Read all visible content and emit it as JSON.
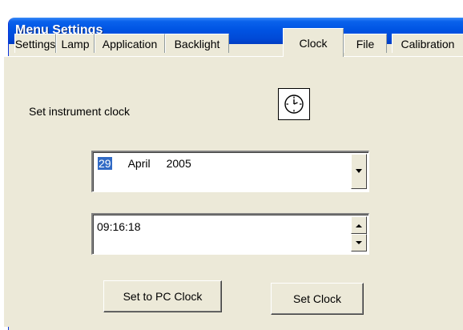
{
  "window": {
    "title": "Menu Settings"
  },
  "tabs": [
    {
      "label": "Settings",
      "active": false
    },
    {
      "label": "Lamp",
      "active": false
    },
    {
      "label": "Application",
      "active": false
    },
    {
      "label": "Backlight",
      "active": false
    },
    {
      "label": "Clock",
      "active": true
    },
    {
      "label": "File",
      "active": false
    },
    {
      "label": "Calibration",
      "active": false
    }
  ],
  "clock_panel": {
    "instruction": "Set instrument clock",
    "icon": "clock-icon",
    "date": {
      "day": "29",
      "month": "April",
      "year": "2005"
    },
    "time": {
      "value": "09:16:18"
    },
    "buttons": {
      "set_to_pc": "Set to PC Clock",
      "set_clock": "Set Clock"
    }
  },
  "colors": {
    "titlebar": "#0054e3",
    "window_bg": "#ece9d8",
    "selection": "#316ac5"
  }
}
